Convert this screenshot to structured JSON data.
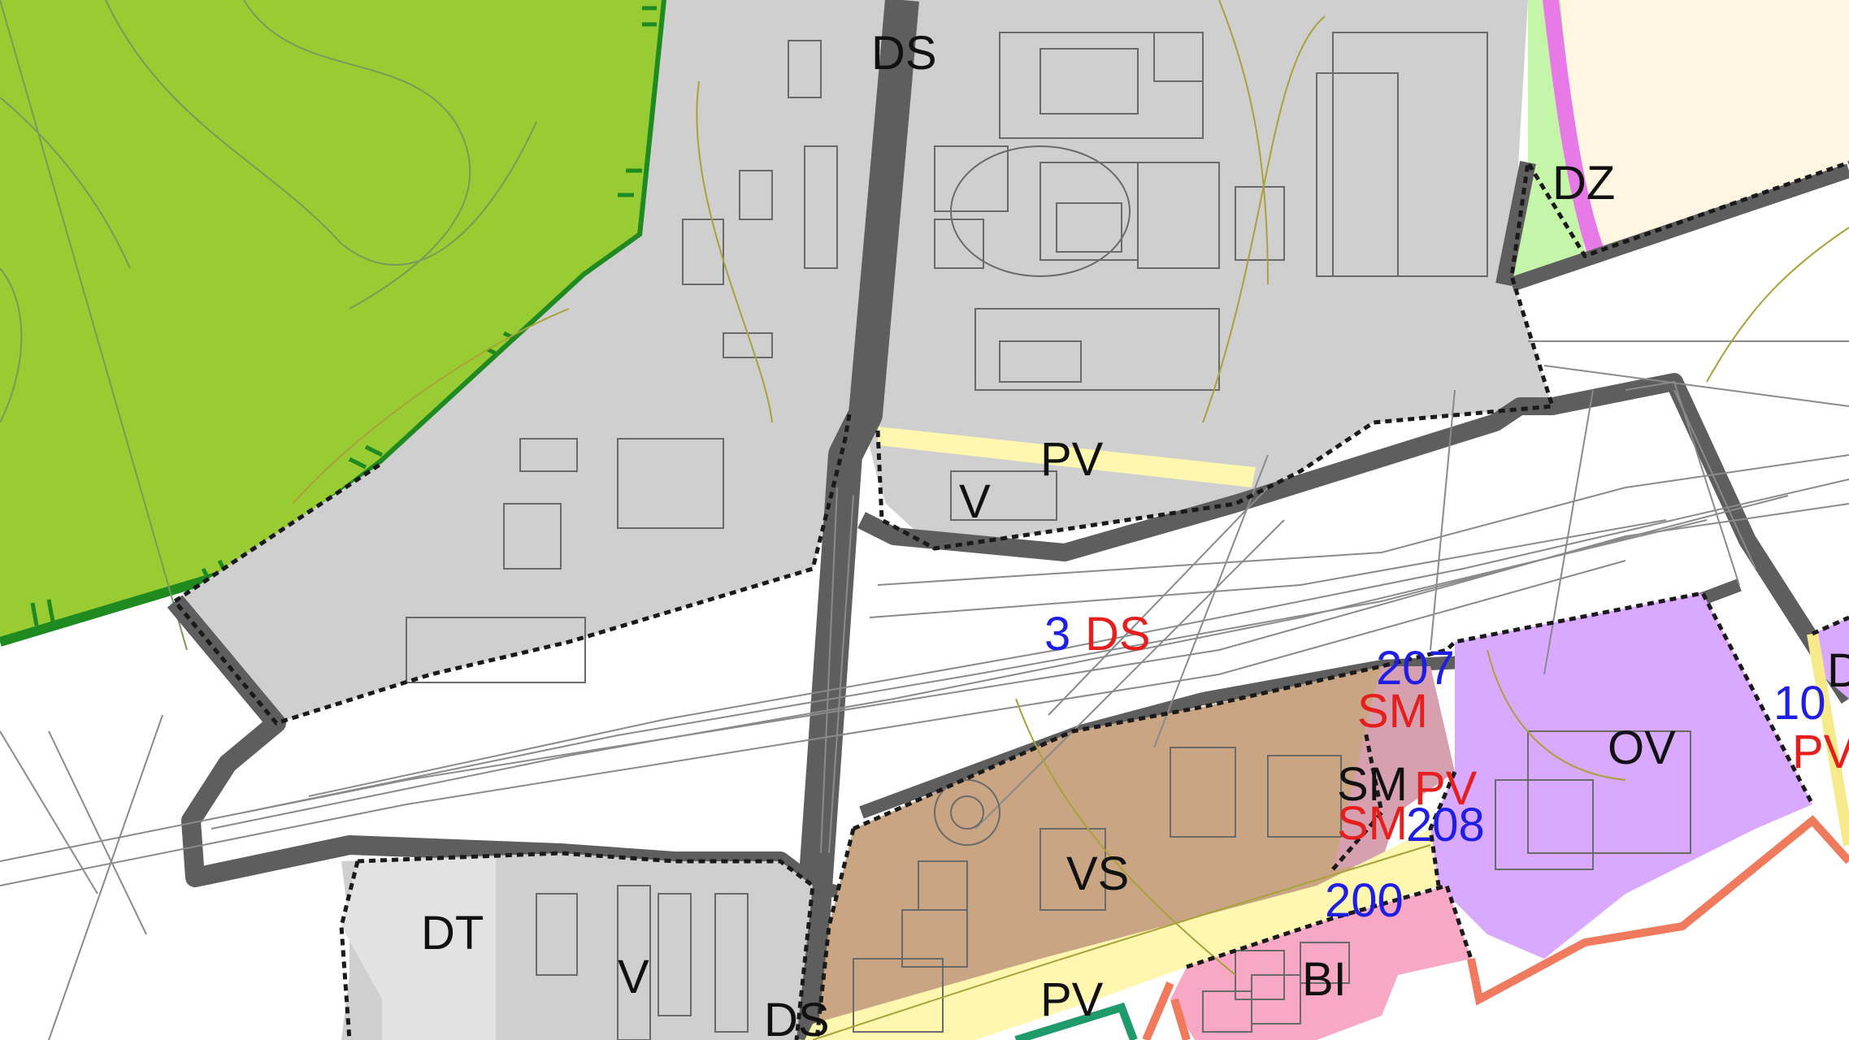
{
  "colors": {
    "forest": "#99cc33",
    "forest_border": "#1f8a1f",
    "industrial": "#cfcfcf",
    "rail_white": "#ffffff",
    "road_gray": "#5e5e5e",
    "park_yellow": "#fff6b0",
    "mixed_brown": "#c9a584",
    "civic_violet": "#d9a8ff",
    "residential_pink": "#f8a8c4",
    "mixed_rose": "#d7a0b0",
    "tech_lightgray": "#e2e2e2",
    "cream": "#fff5e0",
    "greenery_light": "#c4f5a8",
    "magenta_strip": "#e87ae8",
    "salmon_border": "#f07a5e",
    "label_black": "#111111",
    "label_red": "#e61e1e",
    "label_blue": "#1e1ee6"
  },
  "labels": {
    "ds_top": "DS",
    "ds_bottom": "DS",
    "dz": "DZ",
    "pv_top": "PV",
    "pv_bottom": "PV",
    "v_top": "V",
    "v_bottom": "V",
    "dt": "DT",
    "vs": "VS",
    "bi": "BI",
    "ov": "OV",
    "sm_black": "SM",
    "sm_red_1": "SM",
    "sm_red_2": "SM",
    "pv_red_mid": "PV",
    "pv_red_right": "PV",
    "ds_red": "DS",
    "d_right_edge": "D"
  },
  "ids": {
    "n3": "3",
    "n207": "207",
    "n208": "208",
    "n200": "200",
    "n10": "10"
  }
}
